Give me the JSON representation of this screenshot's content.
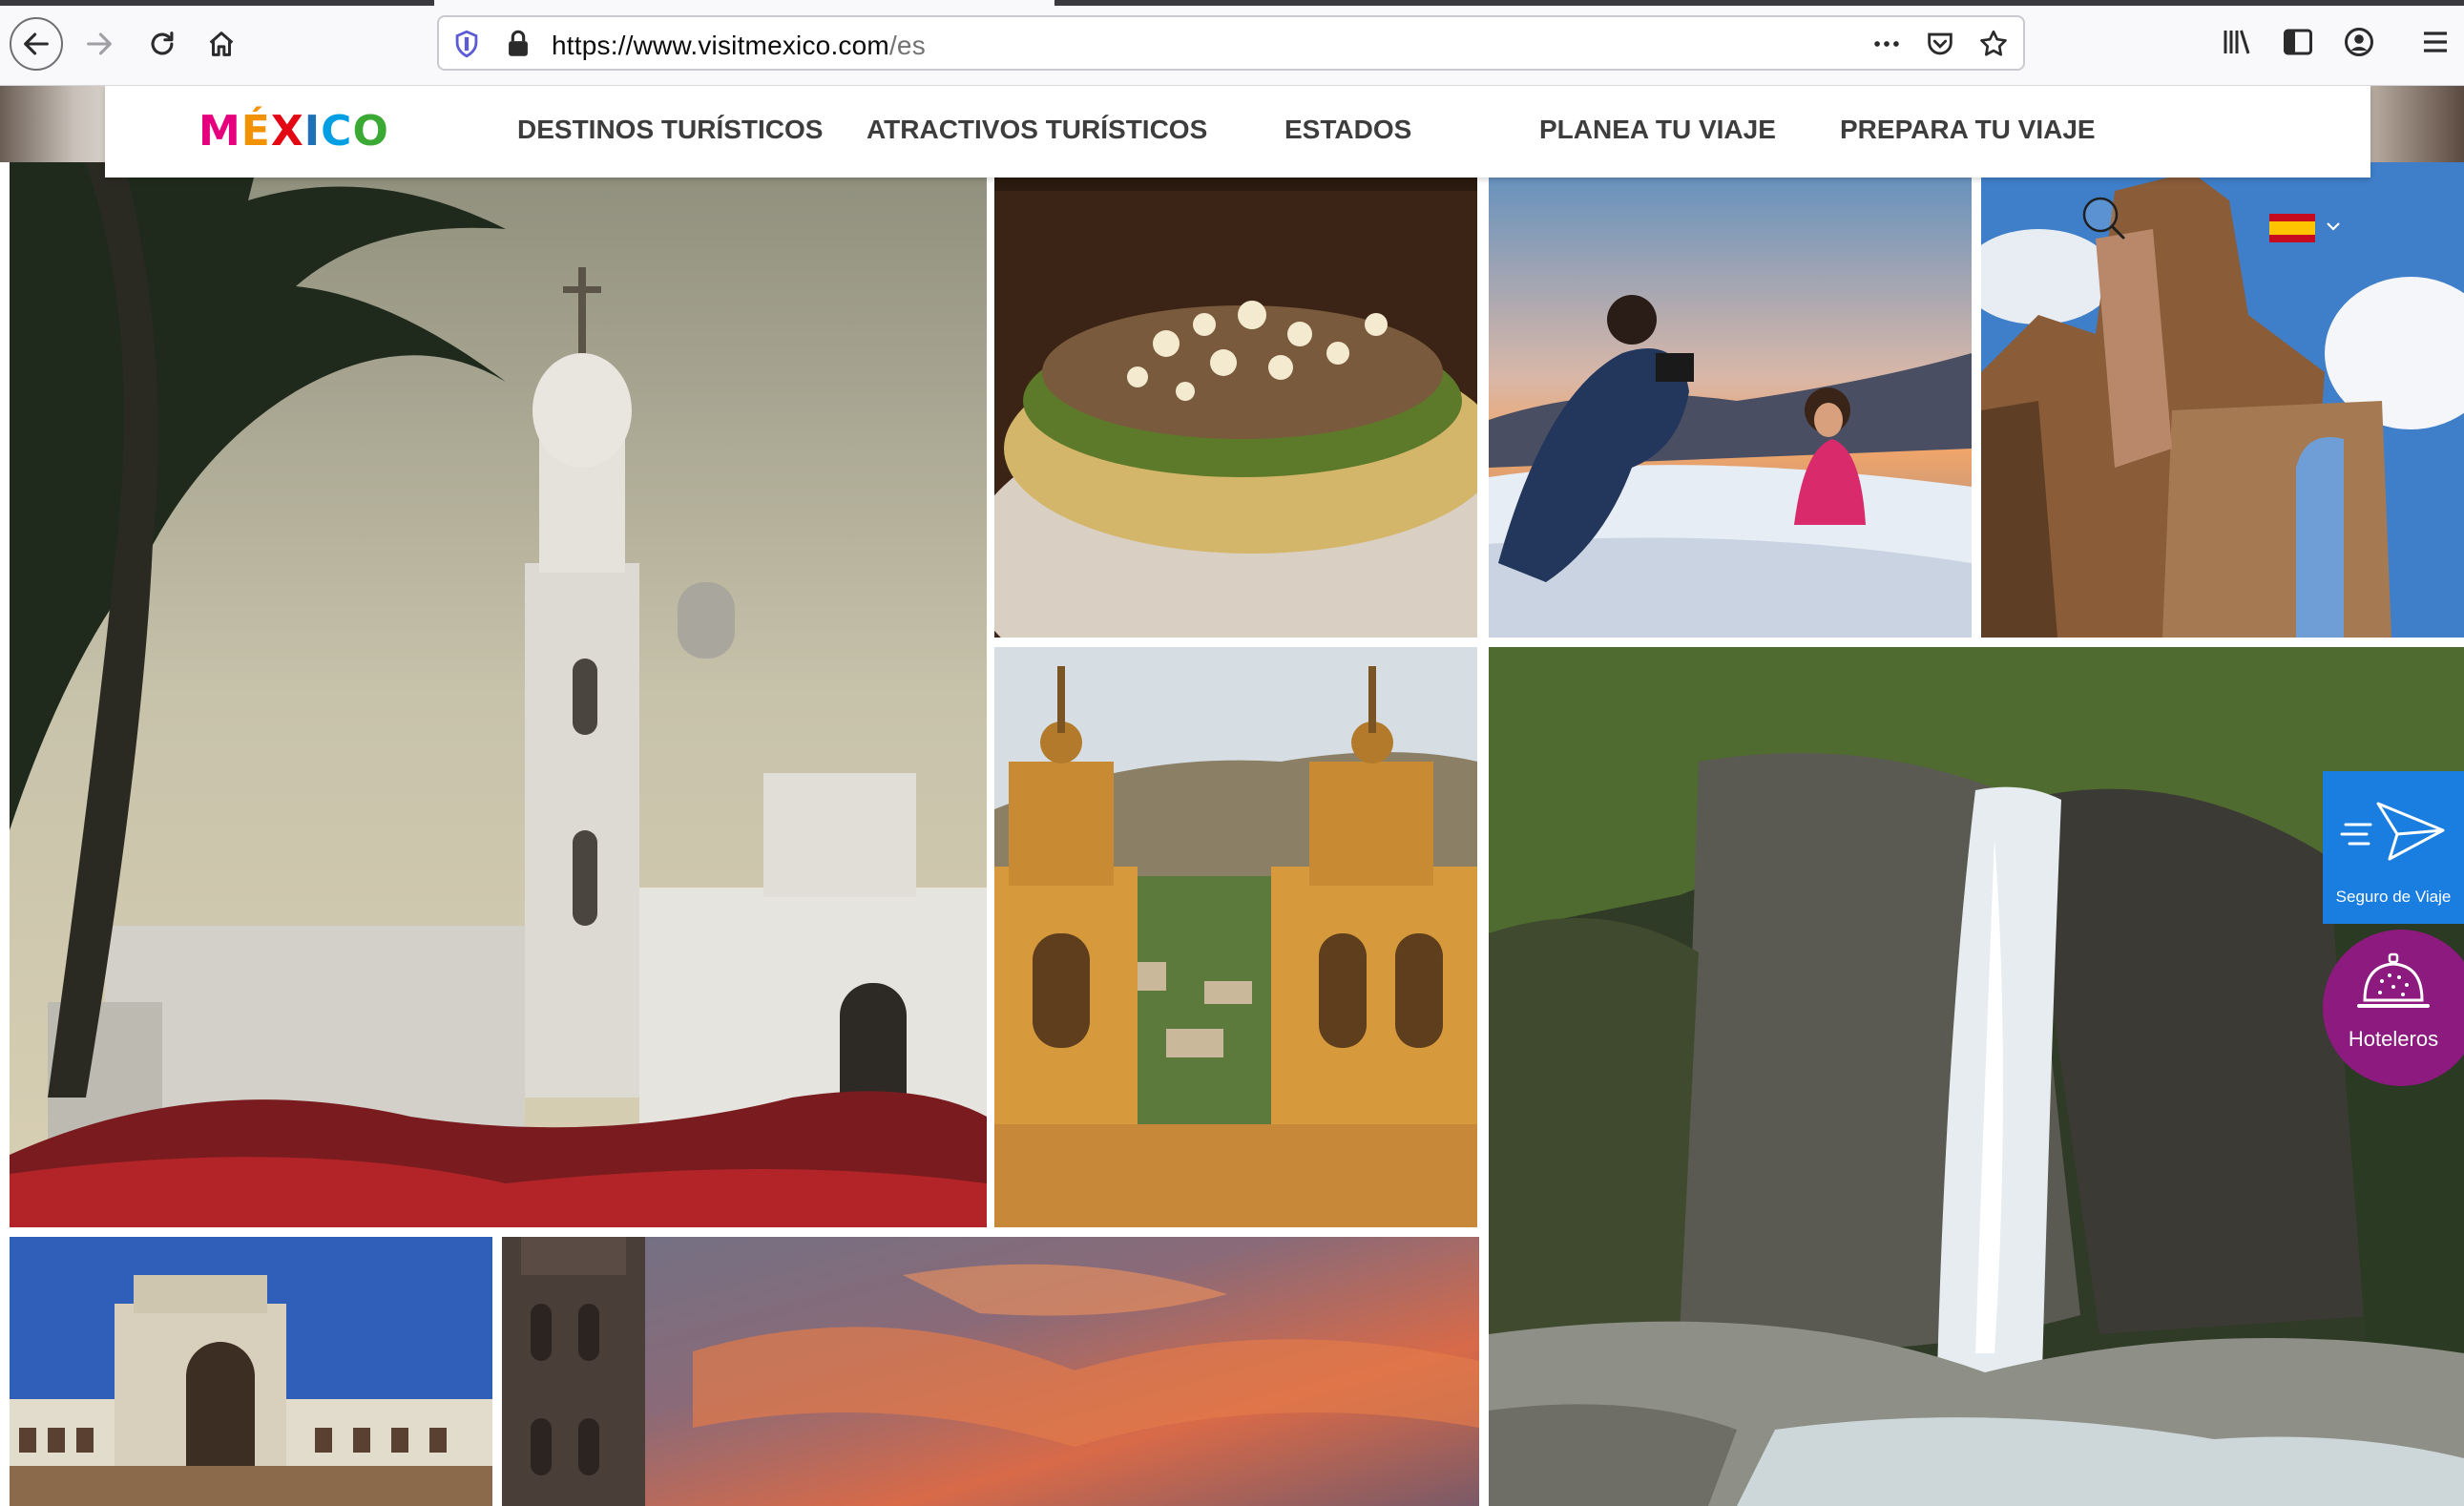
{
  "browser": {
    "url_main": "https://www.visitmexico.com",
    "url_path": "/es"
  },
  "header": {
    "logo": [
      "M",
      "É",
      "X",
      "I",
      "C",
      "O"
    ],
    "logo_colors": [
      "#e6007e",
      "#f39200",
      "#e30613",
      "#1d71b8",
      "#009fe3",
      "#3aaa35"
    ],
    "menu": [
      {
        "label": "DESTINOS TURÍSTICOS"
      },
      {
        "label": "ATRACTIVOS TURÍSTICOS"
      },
      {
        "label": "ESTADOS"
      },
      {
        "label": "PLANEA TU VIAJE"
      },
      {
        "label": "PREPARA TU VIAJE"
      }
    ]
  },
  "gallery": {
    "tiles": [
      {
        "subject": "church with palm tree"
      },
      {
        "subject": "tacos with cheese"
      },
      {
        "subject": "mother photographing child on dunes"
      },
      {
        "subject": "stone ruin with arch"
      },
      {
        "subject": "yellow church towers over town"
      },
      {
        "subject": "waterfall in canyon"
      },
      {
        "subject": "art deco building"
      },
      {
        "subject": "bell tower at sunset"
      }
    ]
  },
  "widgets": {
    "seguro_label": "Seguro de Viaje",
    "hoteleros_label": "Hoteleros"
  },
  "colors": {
    "seguro_bg": "#1a7de0",
    "hoteleros_bg": "#8c1a7f"
  }
}
